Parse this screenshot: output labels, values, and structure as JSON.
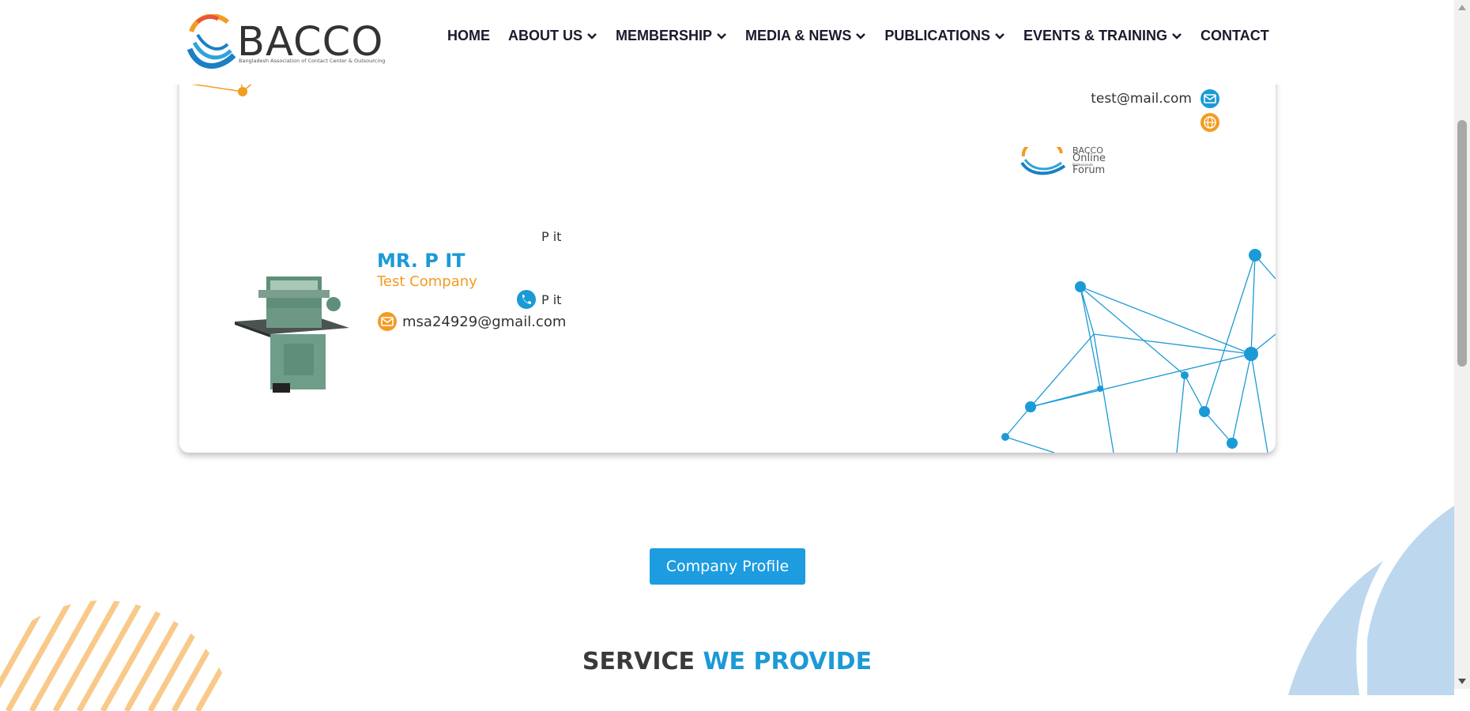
{
  "header": {
    "logo_text": "BACCO",
    "logo_tagline": "Bangladesh Association of Contact Center & Outsourcing",
    "nav": [
      {
        "label": "HOME",
        "dropdown": false
      },
      {
        "label": "ABOUT US",
        "dropdown": true
      },
      {
        "label": "MEMBERSHIP",
        "dropdown": true
      },
      {
        "label": "MEDIA & NEWS",
        "dropdown": true
      },
      {
        "label": "PUBLICATIONS",
        "dropdown": true
      },
      {
        "label": "EVENTS & TRAINING",
        "dropdown": true
      },
      {
        "label": "CONTACT",
        "dropdown": false
      }
    ]
  },
  "card": {
    "contact_email": "test@mail.com",
    "forum_logo_text": [
      "BACCO",
      "Online",
      "Professionals",
      "Forum"
    ],
    "member": {
      "role": "P it",
      "name": "MR. P IT",
      "company": "Test Company",
      "phone": "P it",
      "email": "msa24929@gmail.com"
    }
  },
  "profile_button": "Company Profile",
  "section": {
    "title_dark": "SERVICE",
    "title_accent": "WE PROVIDE"
  },
  "colors": {
    "primary_blue": "#1b9ad6",
    "accent_orange": "#f39c23",
    "button_blue": "#1d9ce0"
  },
  "icons": {
    "email": "envelope-icon",
    "web": "globe-icon",
    "phone": "phone-icon",
    "dropdown": "chevron-down-icon"
  }
}
